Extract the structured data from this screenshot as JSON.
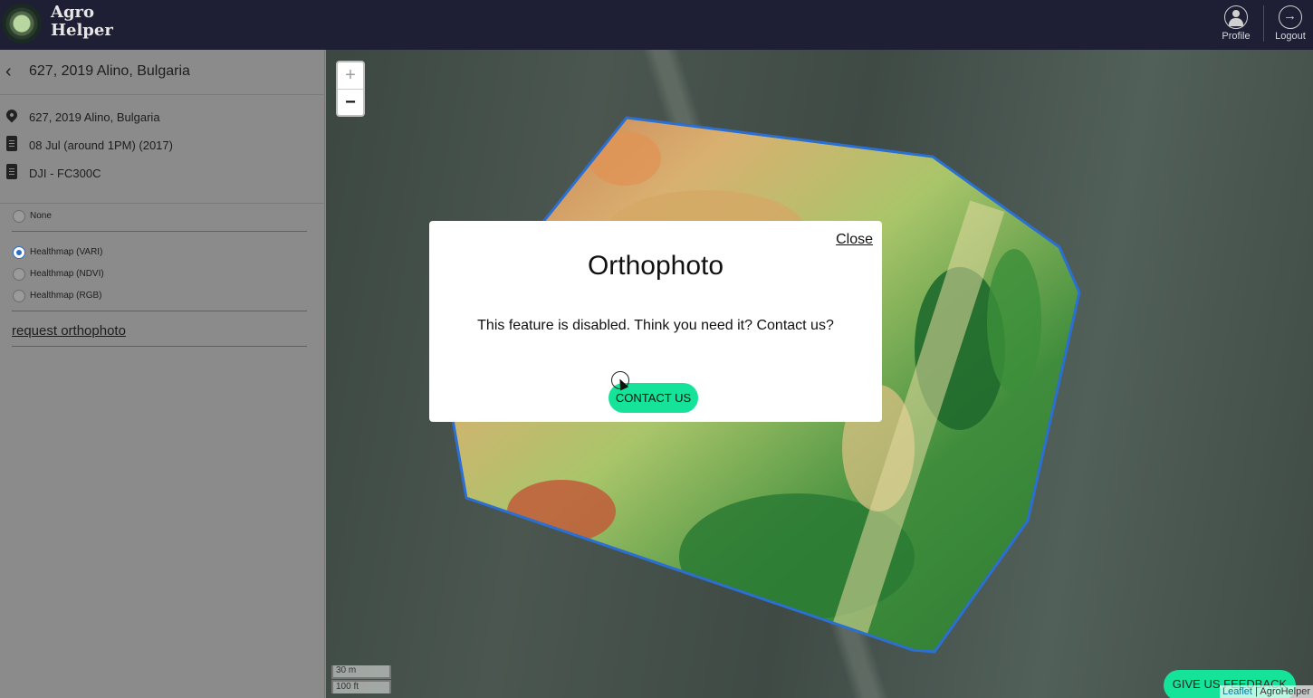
{
  "header": {
    "logo_line1": "Agro",
    "logo_line2": "Helper",
    "profile_label": "Profile",
    "logout_label": "Logout"
  },
  "sidebar": {
    "title": "627, 2019 Alino, Bulgaria",
    "info": [
      {
        "icon": "location-pin-icon",
        "text": "627, 2019 Alino, Bulgaria"
      },
      {
        "icon": "clipboard-icon",
        "text": "08 Jul (around 1PM) (2017)"
      },
      {
        "icon": "clipboard-icon",
        "text": "DJI - FC300C"
      }
    ],
    "layers": [
      {
        "label": "None",
        "checked": false
      },
      {
        "label": "Healthmap (VARI)",
        "checked": true
      },
      {
        "label": "Healthmap (NDVI)",
        "checked": false
      },
      {
        "label": "Healthmap (RGB)",
        "checked": false
      }
    ],
    "request_link": "request orthophoto"
  },
  "map": {
    "zoom_in": "+",
    "zoom_out": "−",
    "scale_metric": "30 m",
    "scale_imperial": "100 ft",
    "attribution_leaflet": "Leaflet",
    "attribution_sep": " | ",
    "attribution_owner": "AgroHelper",
    "feedback_label": "GIVE US FEEDBACK",
    "boundary_color": "#2a6fd1"
  },
  "modal": {
    "close_label": "Close",
    "title": "Orthophoto",
    "message": "This feature is disabled. Think you need it? Contact us?",
    "contact_label": "CONTACT US",
    "accent_color": "#16e39a"
  }
}
